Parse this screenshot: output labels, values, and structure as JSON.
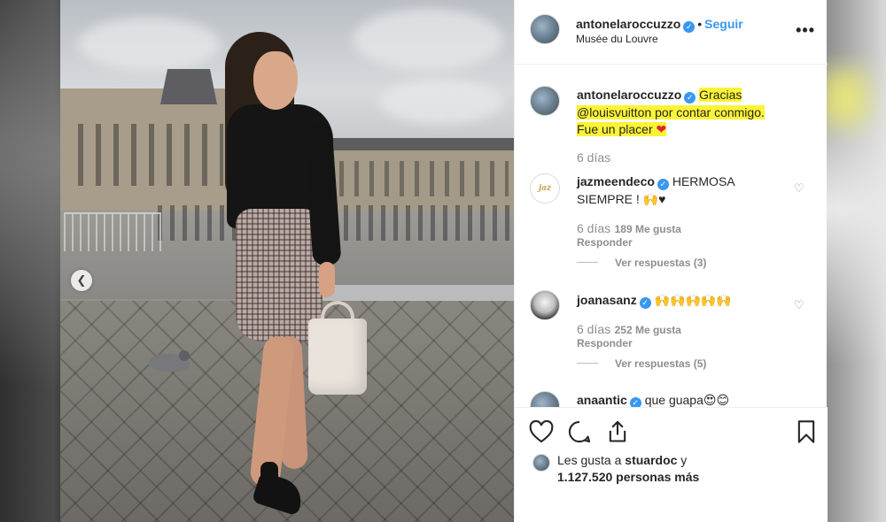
{
  "post": {
    "author": "antonelaroccuzzo",
    "follow_label": "Seguir",
    "separator": "•",
    "location": "Musée du Louvre",
    "more_label": "•••"
  },
  "caption": {
    "author": "antonelaroccuzzo",
    "text_line1": "Gracias",
    "text_line2": "@louisvuitton por contar conmigo.",
    "text_line3": "Fue un placer",
    "heart": "❤",
    "time": "6 días",
    "highlight_color": "#fbf336"
  },
  "comments": [
    {
      "author": "jazmeendeco",
      "text": "HERMOSA SIEMPRE ! 🙌♥",
      "time": "6 días",
      "likes": "189 Me gusta",
      "reply": "Responder",
      "view_replies": "Ver respuestas (3)"
    },
    {
      "author": "joanasanz",
      "text": "🙌🙌🙌🙌🙌",
      "time": "6 días",
      "likes": "252 Me gusta",
      "reply": "Responder",
      "view_replies": "Ver respuestas (5)"
    },
    {
      "author": "anaantic",
      "text": "que guapa😍😊"
    }
  ],
  "likes_summary": {
    "prefix": "Les gusta a ",
    "user": "stuardoc",
    "connector": " y",
    "count": "1.127.520 personas más"
  },
  "icons": {
    "heart": "heart-icon",
    "comment": "comment-icon",
    "share": "share-icon",
    "save": "bookmark-icon",
    "prev": "chevron-left-icon"
  },
  "colors": {
    "accent": "#3897f0",
    "muted": "#8e8e8e",
    "text": "#262626"
  }
}
